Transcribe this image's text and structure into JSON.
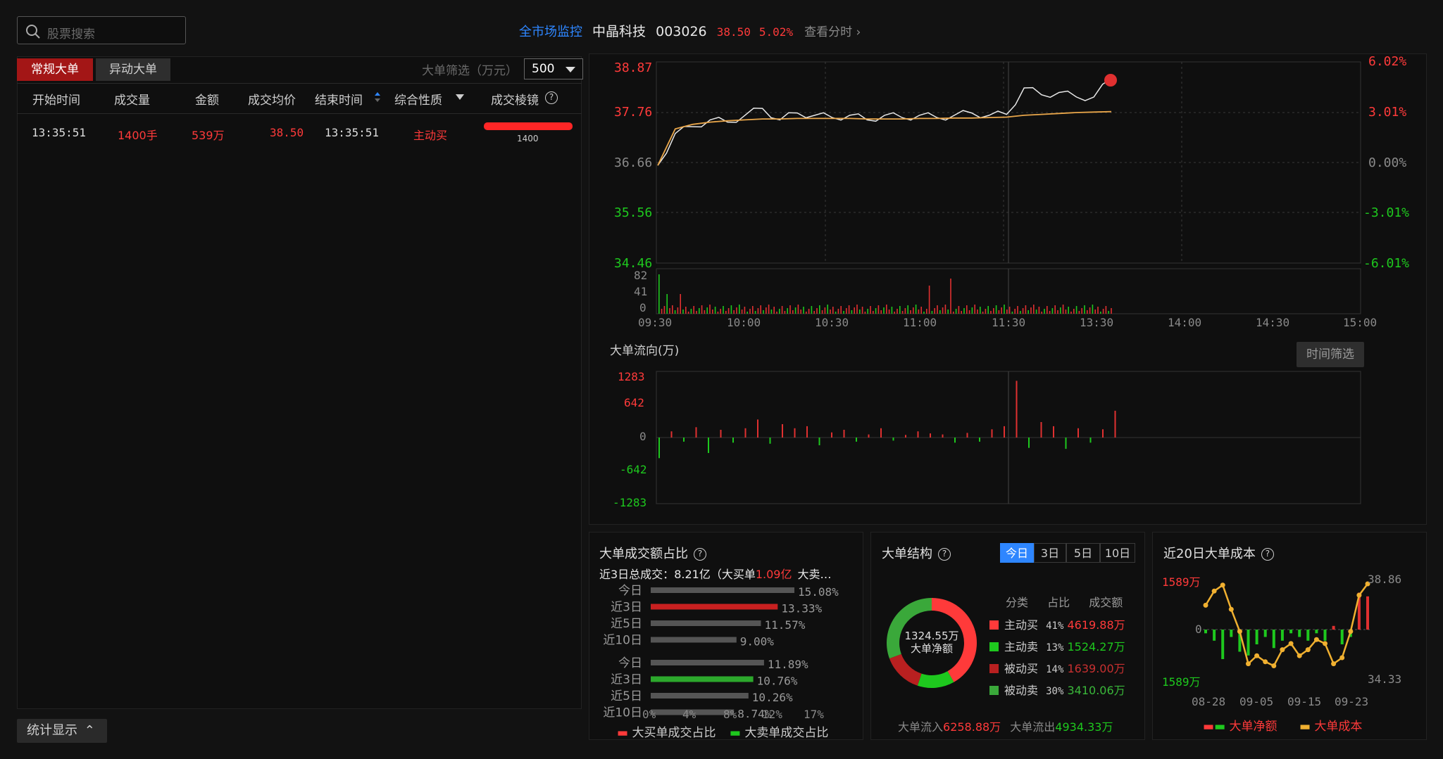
{
  "search": {
    "placeholder": "股票搜索"
  },
  "tabs": [
    {
      "label": "常规大单",
      "active": true
    },
    {
      "label": "异动大单",
      "active": false
    }
  ],
  "filter": {
    "label": "大单筛选（万元）",
    "value": "500"
  },
  "table": {
    "headers": [
      "开始时间",
      "成交量",
      "金额",
      "成交均价",
      "结束时间",
      "综合性质",
      "成交棱镜"
    ],
    "rows": [
      {
        "start": "13:35:51",
        "volume": "1400手",
        "amount": "539万",
        "avg_price": "38.50",
        "end": "13:35:51",
        "nature": "主动买",
        "prism_value": "1400"
      }
    ]
  },
  "header": {
    "monitor_link": "全市场监控",
    "stock_name": "中晶科技",
    "stock_code": "003026",
    "price": "38.50",
    "change_pct": "5.02%",
    "view_minute": "查看分时"
  },
  "price_chart": {
    "y_left": [
      "38.87",
      "37.76",
      "36.66",
      "35.56",
      "34.46"
    ],
    "y_right": [
      "6.02%",
      "3.01%",
      "0.00%",
      "-3.01%",
      "-6.01%"
    ],
    "vol_ticks": [
      "82",
      "41",
      "0"
    ],
    "x_ticks": [
      "09:30",
      "10:00",
      "10:30",
      "11:00",
      "11:30",
      "13:30",
      "14:00",
      "14:30",
      "15:00"
    ]
  },
  "flow_chart": {
    "title": "大单流向(万)",
    "time_filter": "时间筛选",
    "y_ticks": [
      "1283",
      "642",
      "0",
      "-642",
      "-1283"
    ]
  },
  "ratio_panel": {
    "title": "大单成交额占比",
    "summary_prefix": "近3日总成交：",
    "summary_total": "8.21亿",
    "summary_mid": "（大买单",
    "summary_buy": "1.09亿",
    "summary_tail": "大卖…",
    "buy_rows": [
      {
        "label": "今日",
        "value": "15.08%"
      },
      {
        "label": "近3日",
        "value": "13.33%"
      },
      {
        "label": "近5日",
        "value": "11.57%"
      },
      {
        "label": "近10日",
        "value": "9.00%"
      }
    ],
    "sell_rows": [
      {
        "label": "今日",
        "value": "11.89%"
      },
      {
        "label": "近3日",
        "value": "10.76%"
      },
      {
        "label": "近5日",
        "value": "10.26%"
      },
      {
        "label": "近10日",
        "value": "8.74%"
      }
    ],
    "x_ticks": [
      "0%",
      "4%",
      "8%",
      "12%",
      "17%"
    ],
    "legend_buy": "大买单成交占比",
    "legend_sell": "大卖单成交占比"
  },
  "structure_panel": {
    "title": "大单结构",
    "periods": [
      "今日",
      "3日",
      "5日",
      "10日"
    ],
    "donut_value": "1324.55万",
    "donut_label": "大单净额",
    "col_headers": [
      "分类",
      "占比",
      "成交额"
    ],
    "rows": [
      {
        "name": "主动买",
        "pct": "41%",
        "amount": "4619.88万",
        "color": "#ff3a3a"
      },
      {
        "name": "主动卖",
        "pct": "13%",
        "amount": "1524.27万",
        "color": "#1ec81e"
      },
      {
        "name": "被动买",
        "pct": "14%",
        "amount": "1639.00万",
        "color": "#b82020"
      },
      {
        "name": "被动卖",
        "pct": "30%",
        "amount": "3410.06万",
        "color": "#3aa83a"
      }
    ],
    "inflow_label": "大单流入",
    "inflow_value": "6258.88万",
    "outflow_label": "大单流出",
    "outflow_value": "4934.33万"
  },
  "cost_panel": {
    "title": "近20日大单成本",
    "y_left_top": "1589万",
    "y_left_mid": "0",
    "y_left_bottom": "1589万",
    "y_right_top": "38.86",
    "y_right_bottom": "34.33",
    "x_ticks": [
      "08-28",
      "09-05",
      "09-15",
      "09-23"
    ],
    "legend_net": "大单净额",
    "legend_cost": "大单成本"
  },
  "stat_button": {
    "label": "统计显示"
  },
  "chart_data": [
    {
      "type": "line",
      "title": "",
      "x_ticks": [
        "09:30",
        "10:00",
        "10:30",
        "11:00",
        "11:30",
        "13:30",
        "14:00",
        "14:30",
        "15:00"
      ],
      "ylim": [
        34.46,
        38.87
      ],
      "series": [
        {
          "values": [
            36.6,
            37.3,
            37.45,
            37.6,
            37.55,
            37.7,
            37.85,
            37.6,
            37.75,
            37.7,
            37.65,
            37.7,
            37.6,
            37.7,
            37.65,
            37.7,
            37.65,
            37.7,
            37.75,
            37.7,
            37.72,
            38.3,
            38.15,
            38.2,
            38.1,
            38.1,
            38.5
          ]
        },
        {
          "values": [
            36.6,
            37.4,
            37.5,
            37.55,
            37.58,
            37.6,
            37.62,
            37.62,
            37.63,
            37.63,
            37.63,
            37.63,
            37.62,
            37.62,
            37.62,
            37.63,
            37.63,
            37.64,
            37.64,
            37.65,
            37.66,
            37.7,
            37.72,
            37.74,
            37.76,
            37.77,
            37.78
          ]
        }
      ]
    },
    {
      "type": "bar",
      "title": "大单流向(万)",
      "ylim": [
        -1283,
        1283
      ],
      "values": [
        -400,
        120,
        -80,
        200,
        -300,
        150,
        -100,
        180,
        350,
        -120,
        260,
        180,
        220,
        -150,
        100,
        150,
        -80,
        60,
        180,
        -60,
        50,
        120,
        80,
        60,
        -100,
        90,
        -80,
        160,
        220,
        1100,
        -200,
        300,
        220,
        -220,
        180,
        -100,
        160,
        520
      ]
    },
    {
      "type": "bar",
      "title": "大单成交额占比",
      "categories": [
        "今日",
        "近3日",
        "近5日",
        "近10日",
        "今日",
        "近3日",
        "近5日",
        "近10日"
      ],
      "values": [
        15.08,
        13.33,
        11.57,
        9.0,
        11.89,
        10.76,
        10.26,
        8.74
      ],
      "xlim": [
        0,
        17
      ]
    },
    {
      "type": "pie",
      "title": "大单结构",
      "categories": [
        "主动买",
        "主动卖",
        "被动买",
        "被动卖"
      ],
      "values": [
        41,
        13,
        14,
        30
      ]
    },
    {
      "type": "bar",
      "title": "近20日大单成本",
      "x_ticks": [
        "08-28",
        "09-05",
        "09-15",
        "09-23"
      ],
      "net_values": [
        -0.1,
        -0.3,
        -0.8,
        -0.2,
        -0.6,
        -0.7,
        -0.4,
        -0.2,
        -0.5,
        -0.3,
        -0.1,
        -0.2,
        -0.3,
        -0.1,
        -0.3,
        0.1,
        -0.4,
        -0.2,
        1.0,
        0.9
      ],
      "cost_values": [
        37.8,
        38.5,
        38.8,
        37.6,
        36.5,
        34.9,
        35.3,
        35.0,
        34.8,
        35.6,
        35.9,
        35.3,
        35.6,
        36.1,
        35.9,
        34.9,
        35.2,
        36.5,
        38.3,
        38.86
      ],
      "ylim_right": [
        34.33,
        38.86
      ]
    }
  ]
}
